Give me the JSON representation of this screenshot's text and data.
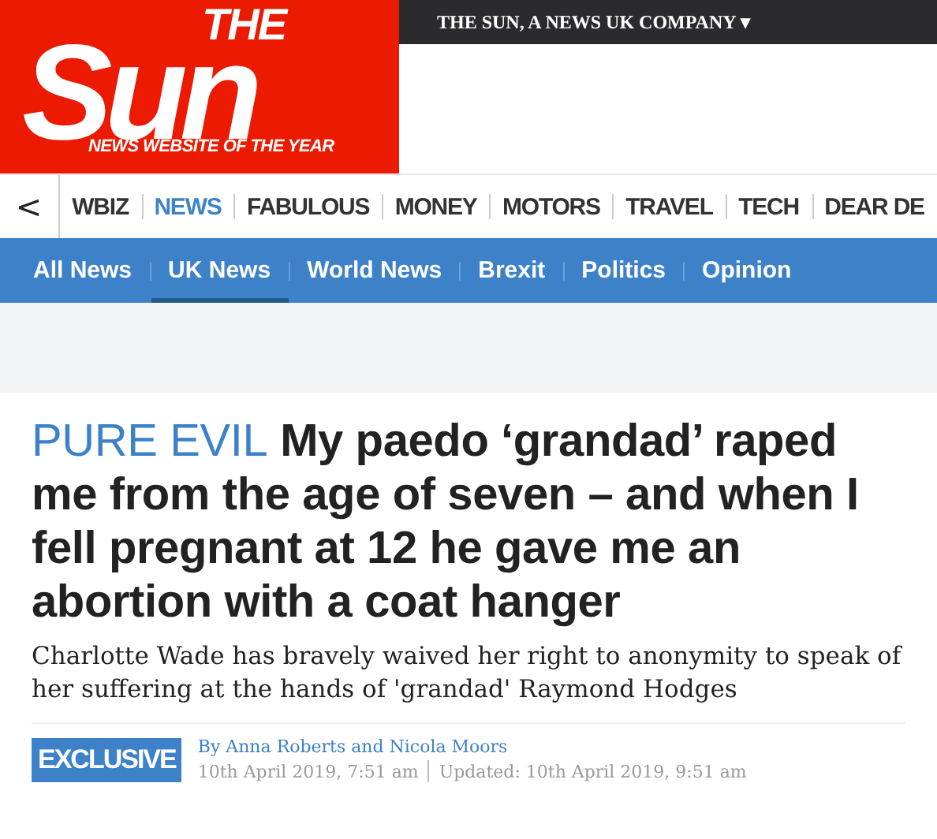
{
  "logo": {
    "small": "THE",
    "big": "Sun",
    "tagline": "NEWS WEBSITE OF THE YEAR"
  },
  "top_bar": {
    "label": "THE SUN, A NEWS UK COMPANY",
    "caret": "▾"
  },
  "nav": {
    "back": "<",
    "items": [
      {
        "label": "WBIZ",
        "selected": false
      },
      {
        "label": "NEWS",
        "selected": true
      },
      {
        "label": "FABULOUS",
        "selected": false
      },
      {
        "label": "MONEY",
        "selected": false
      },
      {
        "label": "MOTORS",
        "selected": false
      },
      {
        "label": "TRAVEL",
        "selected": false
      },
      {
        "label": "TECH",
        "selected": false
      },
      {
        "label": "DEAR DE",
        "selected": false
      }
    ]
  },
  "subnav": [
    {
      "label": "All News",
      "selected": false
    },
    {
      "label": "UK News",
      "selected": true
    },
    {
      "label": "World News",
      "selected": false
    },
    {
      "label": "Brexit",
      "selected": false
    },
    {
      "label": "Politics",
      "selected": false
    },
    {
      "label": "Opinion",
      "selected": false
    }
  ],
  "article": {
    "kicker": "PURE EVIL",
    "headline": "My paedo  ‘grandad’ raped me from the age of seven – and when I fell pregnant at 12 he gave me an abortion with a coat hanger",
    "standfirst": "Charlotte Wade has bravely waived her right to anonymity to speak of her suffering at the hands of 'grandad' Raymond Hodges",
    "badge": "EXCLUSIVE",
    "byline": "By Anna Roberts and Nicola Moors",
    "published": "10th April 2019, 7:51 am",
    "updated": "Updated: 10th April 2019, 9:51 am"
  }
}
